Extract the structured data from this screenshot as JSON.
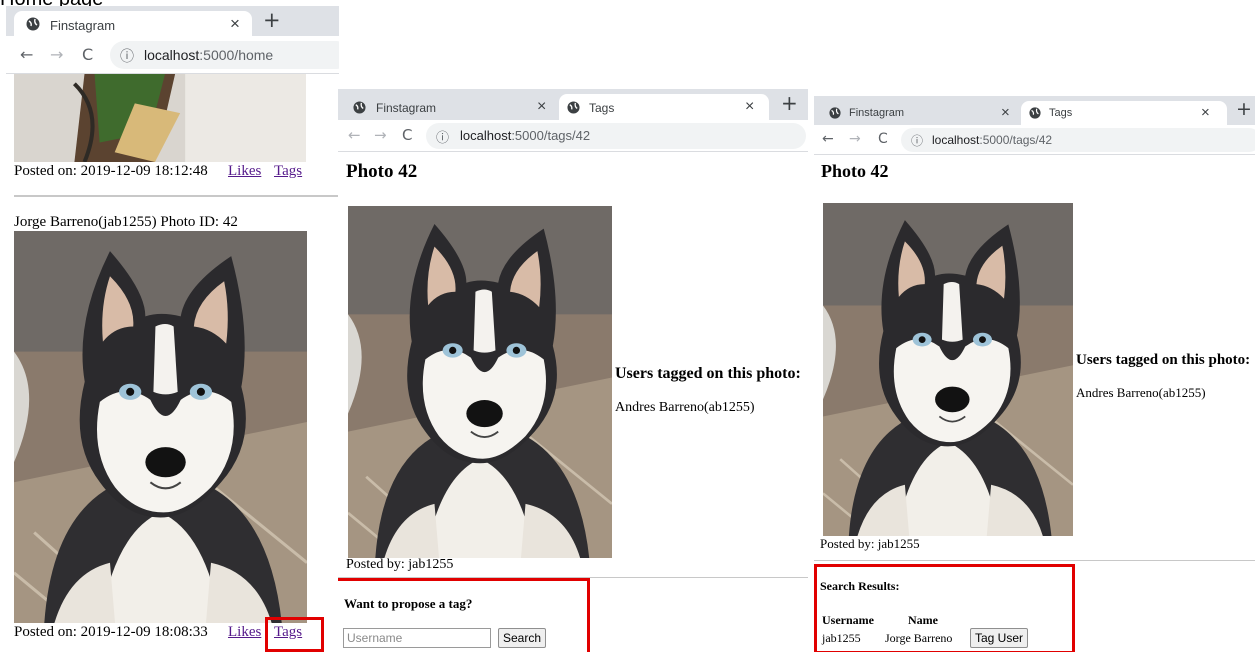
{
  "caption": "Home page",
  "panels": [
    {
      "tabs": [
        {
          "title": "Finstagram",
          "close": "×"
        }
      ],
      "new_tab": "+",
      "url_host": "localhost",
      "url_path": ":5000/home",
      "nav": {
        "back": "←",
        "forward": "→",
        "reload": "C",
        "info": "ⓘ"
      },
      "posts": [
        {
          "posted_label": "Posted on: 2019-12-09 18:12:48",
          "likes": "Likes",
          "tags": "Tags"
        },
        {
          "header": "Jorge Barreno(jab1255)  Photo ID: 42",
          "posted_label": "Posted on: 2019-12-09 18:08:33",
          "likes": "Likes",
          "tags": "Tags"
        }
      ]
    },
    {
      "tabs": [
        {
          "title": "Finstagram",
          "close": "×"
        },
        {
          "title": "Tags",
          "close": "×"
        }
      ],
      "new_tab": "+",
      "url_host": "localhost",
      "url_path": ":5000/tags/42",
      "nav": {
        "back": "←",
        "forward": "→",
        "reload": "C",
        "info": "ⓘ"
      },
      "heading": "Photo 42",
      "tagged_heading": "Users tagged on this photo:",
      "tagged_users": [
        "Andres Barreno(ab1255)"
      ],
      "posted_by": "Posted by: jab1255",
      "propose_heading": "Want to propose a tag?",
      "search_placeholder": "Username",
      "search_button": "Search"
    },
    {
      "tabs": [
        {
          "title": "Finstagram",
          "close": "×"
        },
        {
          "title": "Tags",
          "close": "×"
        }
      ],
      "new_tab": "+",
      "url_host": "localhost",
      "url_path": ":5000/tags/42",
      "nav": {
        "back": "←",
        "forward": "→",
        "reload": "C",
        "info": "ⓘ"
      },
      "heading": "Photo 42",
      "tagged_heading": "Users tagged on this photo:",
      "tagged_users": [
        "Andres Barreno(ab1255)"
      ],
      "posted_by": "Posted by: jab1255",
      "results_heading": "Search Results:",
      "columns": [
        "Username",
        "Name"
      ],
      "results": [
        {
          "username": "jab1255",
          "name": "Jorge Barreno",
          "action": "Tag User"
        }
      ]
    }
  ],
  "colors": {
    "highlight": "#e10000",
    "visited_link": "#551a8b",
    "tabstrip": "#dee1e6"
  }
}
